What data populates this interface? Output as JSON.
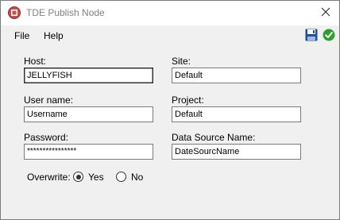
{
  "window": {
    "title": "TDE Publish Node"
  },
  "menu": {
    "file": "File",
    "help": "Help"
  },
  "form": {
    "host": {
      "label": "Host:",
      "value": "JELLYFISH"
    },
    "site": {
      "label": "Site:",
      "value": "Default"
    },
    "username": {
      "label": "User name:",
      "value": "Username"
    },
    "project": {
      "label": "Project:",
      "value": "Default"
    },
    "password": {
      "label": "Password:",
      "value": "****************"
    },
    "datasource": {
      "label": "Data Source Name:",
      "value": "DateSourcName"
    },
    "overwrite": {
      "label": "Overwrite:",
      "yes": "Yes",
      "no": "No",
      "selected": "Yes"
    }
  },
  "colors": {
    "save_icon": "#1f4e9c",
    "ok_icon": "#2e9e2e",
    "app_icon": "#b03030"
  },
  "icons": {
    "save": "floppy-disk-icon",
    "ok": "green-check-icon",
    "close": "close-icon",
    "app": "app-icon"
  }
}
